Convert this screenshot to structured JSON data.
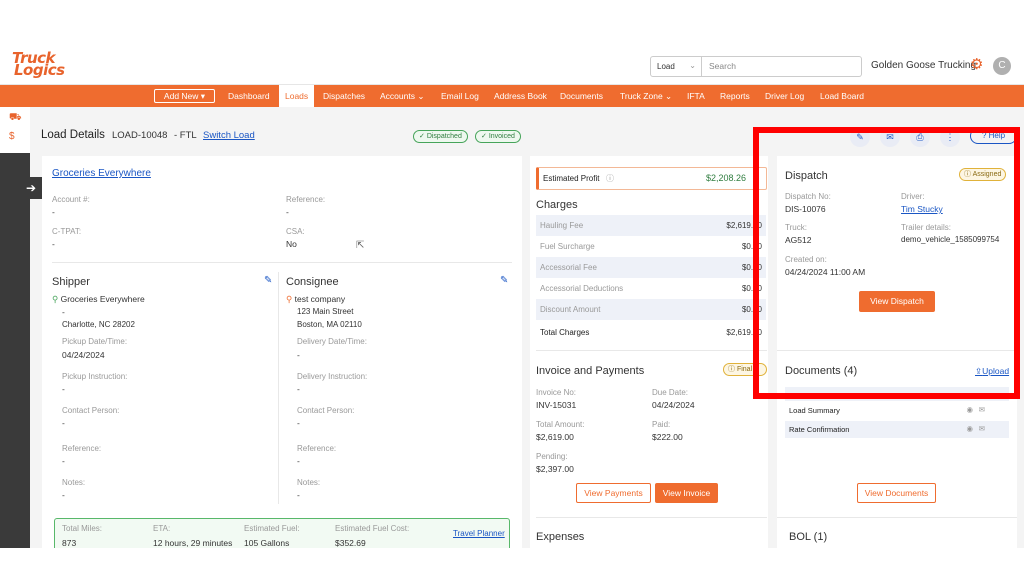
{
  "header": {
    "logo_line1": "Truck",
    "logo_line2": "Logics",
    "search_type": "Load",
    "search_placeholder": "Search",
    "company": "Golden Goose Trucking",
    "avatar_initial": "C"
  },
  "nav": {
    "add_new": "Add New",
    "items": [
      "Dashboard",
      "Loads",
      "Dispatches",
      "Accounts",
      "Email Log",
      "Address Book",
      "Documents",
      "Truck Zone",
      "IFTA",
      "Reports",
      "Driver Log",
      "Load Board"
    ],
    "active": "Loads"
  },
  "load": {
    "title": "Load Details",
    "id": "LOAD-10048",
    "type": "- FTL",
    "switch": "Switch Load",
    "badges": [
      "Dispatched",
      "Invoiced"
    ],
    "help": "Help"
  },
  "customer": {
    "name": "Groceries Everywhere",
    "account_label": "Account #:",
    "account_val": "-",
    "reference_label": "Reference:",
    "reference_val": "-",
    "ctpat_label": "C-TPAT:",
    "ctpat_val": "-",
    "csa_label": "CSA:",
    "csa_val": "No"
  },
  "shipper": {
    "title": "Shipper",
    "name": "Groceries Everywhere",
    "address1": "-",
    "address2": "Charlotte, NC 28202",
    "date_label": "Pickup Date/Time:",
    "date_val": "04/24/2024",
    "instr_label": "Pickup Instruction:",
    "instr_val": "-",
    "contact_label": "Contact Person:",
    "contact_val": "-",
    "ref_label": "Reference:",
    "ref_val": "-",
    "notes_label": "Notes:",
    "notes_val": "-"
  },
  "consignee": {
    "title": "Consignee",
    "name": "test company",
    "address1": "123 Main Street",
    "address2": "Boston, MA 02110",
    "date_label": "Delivery Date/Time:",
    "date_val": "-",
    "instr_label": "Delivery Instruction:",
    "instr_val": "-",
    "contact_label": "Contact Person:",
    "contact_val": "-",
    "ref_label": "Reference:",
    "ref_val": "-",
    "notes_label": "Notes:",
    "notes_val": "-"
  },
  "trip": {
    "miles_label": "Total Miles:",
    "miles_val": "873",
    "eta_label": "ETA:",
    "eta_val": "12 hours, 29 minutes",
    "fuel_label": "Estimated Fuel:",
    "fuel_val": "105 Gallons",
    "cost_label": "Estimated Fuel Cost:",
    "cost_val": "$352.69",
    "planner": "Travel Planner"
  },
  "profit": {
    "label": "Estimated Profit",
    "value": "$2,208.26"
  },
  "charges": {
    "title": "Charges",
    "rows": [
      {
        "name": "Hauling Fee",
        "amount": "$2,619.00"
      },
      {
        "name": "Fuel Surcharge",
        "amount": "$0.00"
      },
      {
        "name": "Accessorial Fee",
        "amount": "$0.00"
      },
      {
        "name": "Accessorial Deductions",
        "amount": "$0.00"
      },
      {
        "name": "Discount Amount",
        "amount": "$0.00"
      }
    ],
    "total_label": "Total Charges",
    "total_val": "$2,619.00"
  },
  "invoice": {
    "title": "Invoice and Payments",
    "status": "Final",
    "no_label": "Invoice No:",
    "no_val": "INV-15031",
    "due_label": "Due Date:",
    "due_val": "04/24/2024",
    "total_label": "Total Amount:",
    "total_val": "$2,619.00",
    "paid_label": "Paid:",
    "paid_val": "$222.00",
    "pending_label": "Pending:",
    "pending_val": "$2,397.00",
    "view_payments": "View Payments",
    "view_invoice": "View Invoice"
  },
  "expenses": {
    "title": "Expenses"
  },
  "dispatch": {
    "title": "Dispatch",
    "status": "Assigned",
    "no_label": "Dispatch No:",
    "no_val": "DIS-10076",
    "driver_label": "Driver:",
    "driver_val": "Tim Stucky",
    "truck_label": "Truck:",
    "truck_val": "AG512",
    "trailer_label": "Trailer details:",
    "trailer_val": "demo_vehicle_1585099754",
    "created_label": "Created on:",
    "created_val": "04/24/2024 11:00 AM",
    "view": "View Dispatch"
  },
  "documents": {
    "title": "Documents (4)",
    "upload": "Upload",
    "items": [
      "Load Summary",
      "Rate Confirmation"
    ],
    "view": "View Documents"
  },
  "bol": {
    "title": "BOL (1)"
  },
  "colors": {
    "accent": "#ef6c2f",
    "link": "#1a56c4",
    "success": "#46a45a",
    "highlight": "#ff0000"
  }
}
